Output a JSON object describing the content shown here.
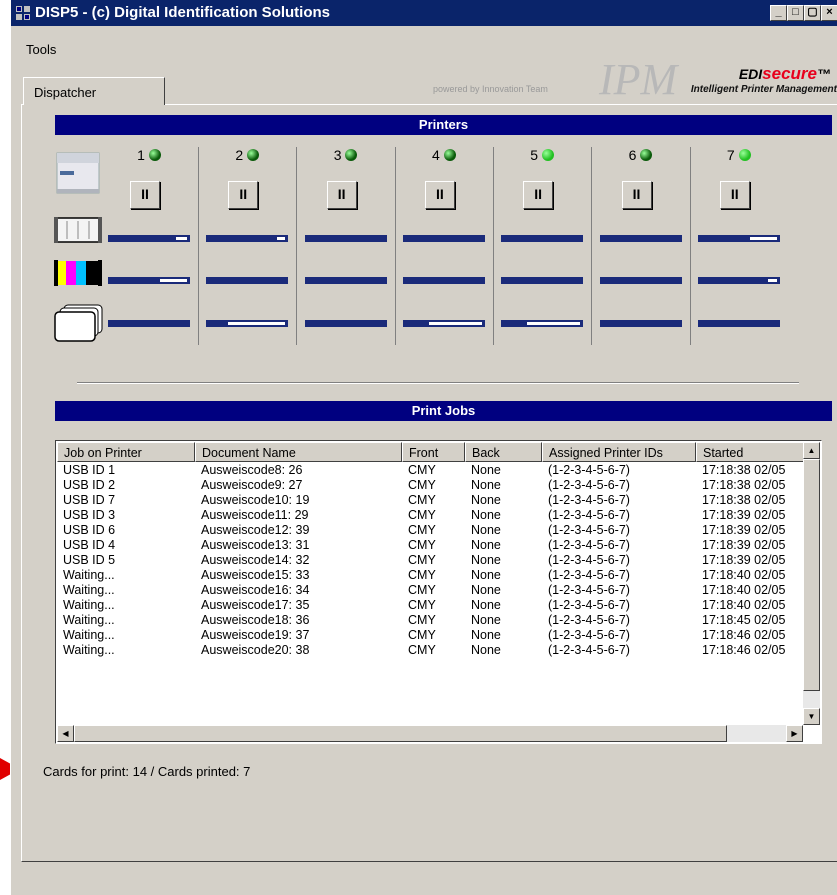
{
  "window": {
    "title": "DISP5 - (c) Digital Identification Solutions",
    "controls": {
      "minimize": "_",
      "restore": "□",
      "close": "×"
    }
  },
  "menu": {
    "tools": "Tools"
  },
  "tabs": [
    {
      "label": "Dispatcher",
      "selected": true
    }
  ],
  "branding": {
    "powered_by": "powered by Innovation Team",
    "ipm": "IPM",
    "edi_prefix": "EDI",
    "edi_suffix": "secure",
    "tm": "™",
    "subtitle": "Intelligent Printer Management"
  },
  "printers_section": {
    "header": "Printers",
    "icons": [
      "printer-icon",
      "ribbon-cassette-icon",
      "color-ribbon-icon",
      "cards-stack-icon"
    ],
    "printers": [
      {
        "id": "1",
        "led": "#0a5a0a",
        "pause": "II",
        "ribbon_level": 0.15,
        "color_level": 0.35,
        "cards_level": 0.0
      },
      {
        "id": "2",
        "led": "#0a5a0a",
        "pause": "II",
        "ribbon_level": 0.1,
        "color_level": 0.0,
        "cards_level": 0.75
      },
      {
        "id": "3",
        "led": "#0a5a0a",
        "pause": "II",
        "ribbon_level": 0.0,
        "color_level": 0.0,
        "cards_level": 0.0
      },
      {
        "id": "4",
        "led": "#0a5a0a",
        "pause": "II",
        "ribbon_level": 0.0,
        "color_level": 0.0,
        "cards_level": 0.7
      },
      {
        "id": "5",
        "led": "#22c022",
        "pause": "II",
        "ribbon_level": 0.0,
        "color_level": 0.0,
        "cards_level": 0.7
      },
      {
        "id": "6",
        "led": "#0a5a0a",
        "pause": "II",
        "ribbon_level": 0.0,
        "color_level": 0.0,
        "cards_level": 0.0
      },
      {
        "id": "7",
        "led": "#22c022",
        "pause": "II",
        "ribbon_level": 0.35,
        "color_level": 0.12,
        "cards_level": 0.0
      }
    ]
  },
  "jobs_section": {
    "header": "Print Jobs",
    "columns": [
      "Job on Printer",
      "Document Name",
      "Front",
      "Back",
      "Assigned Printer IDs",
      "Started"
    ],
    "rows": [
      [
        "USB ID 1",
        "Ausweiscode8: 26",
        "CMY",
        "None",
        "(1-2-3-4-5-6-7)",
        "17:18:38 02/05"
      ],
      [
        "USB ID 2",
        "Ausweiscode9: 27",
        "CMY",
        "None",
        "(1-2-3-4-5-6-7)",
        "17:18:38 02/05"
      ],
      [
        "USB ID 7",
        "Ausweiscode10: 19",
        "CMY",
        "None",
        "(1-2-3-4-5-6-7)",
        "17:18:38 02/05"
      ],
      [
        "USB ID 3",
        "Ausweiscode11: 29",
        "CMY",
        "None",
        "(1-2-3-4-5-6-7)",
        "17:18:39 02/05"
      ],
      [
        "USB ID 6",
        "Ausweiscode12: 39",
        "CMY",
        "None",
        "(1-2-3-4-5-6-7)",
        "17:18:39 02/05"
      ],
      [
        "USB ID 4",
        "Ausweiscode13: 31",
        "CMY",
        "None",
        "(1-2-3-4-5-6-7)",
        "17:18:39 02/05"
      ],
      [
        "USB ID 5",
        "Ausweiscode14: 32",
        "CMY",
        "None",
        "(1-2-3-4-5-6-7)",
        "17:18:39 02/05"
      ],
      [
        "Waiting...",
        "Ausweiscode15: 33",
        "CMY",
        "None",
        "(1-2-3-4-5-6-7)",
        "17:18:40 02/05"
      ],
      [
        "Waiting...",
        "Ausweiscode16: 34",
        "CMY",
        "None",
        "(1-2-3-4-5-6-7)",
        "17:18:40 02/05"
      ],
      [
        "Waiting...",
        "Ausweiscode17: 35",
        "CMY",
        "None",
        "(1-2-3-4-5-6-7)",
        "17:18:40 02/05"
      ],
      [
        "Waiting...",
        "Ausweiscode18: 36",
        "CMY",
        "None",
        "(1-2-3-4-5-6-7)",
        "17:18:45 02/05"
      ],
      [
        "Waiting...",
        "Ausweiscode19: 37",
        "CMY",
        "None",
        "(1-2-3-4-5-6-7)",
        "17:18:46 02/05"
      ],
      [
        "Waiting...",
        "Ausweiscode20: 38",
        "CMY",
        "None",
        "(1-2-3-4-5-6-7)",
        "17:18:46 02/05"
      ]
    ]
  },
  "status": {
    "text": "Cards for print: 14 / Cards printed: 7"
  },
  "colors": {
    "titlebar": "#0a246a",
    "section_header": "#000080",
    "level_bar": "#1a2a7a",
    "annotation_arrow": "#e00000"
  }
}
